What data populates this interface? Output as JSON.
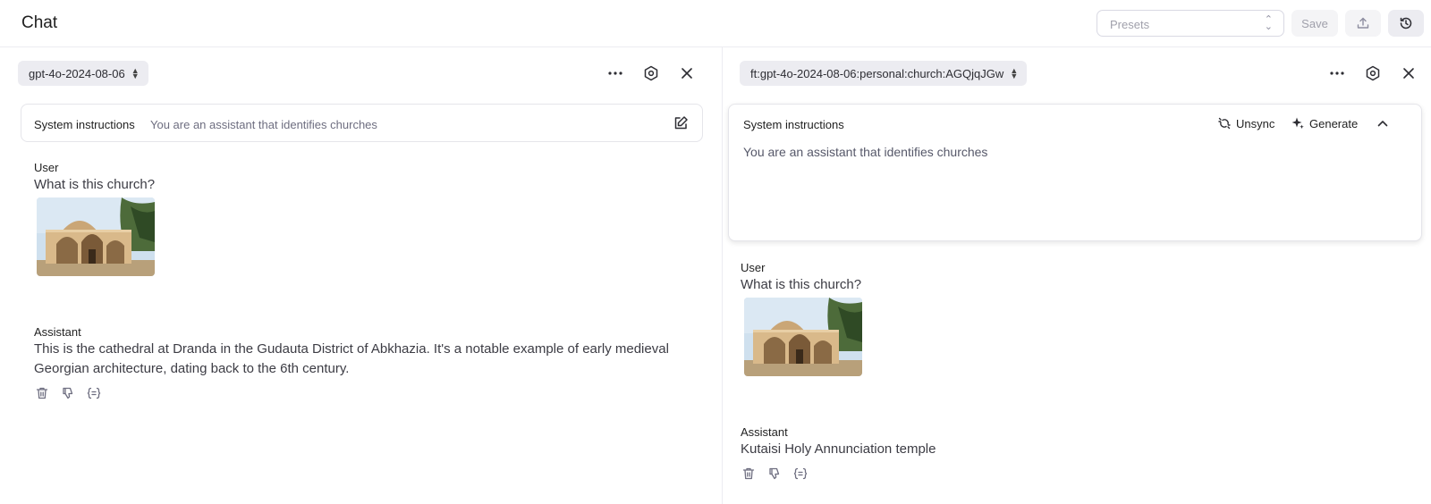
{
  "header": {
    "title": "Chat",
    "presets_placeholder": "Presets",
    "save_label": "Save"
  },
  "left_panel": {
    "model": "gpt-4o-2024-08-06",
    "system": {
      "label": "System instructions",
      "text": "You are an assistant that identifies churches"
    },
    "messages": [
      {
        "role": "User",
        "text": "What is this church?",
        "has_image": true
      },
      {
        "role": "Assistant",
        "text": "This is the cathedral at Dranda in the Gudauta District of Abkhazia. It's a notable example of early medieval Georgian architecture, dating back to the 6th century."
      }
    ],
    "tools": [
      "trash-icon",
      "thumbs-down-icon",
      "json-braces-icon"
    ]
  },
  "right_panel": {
    "model": "ft:gpt-4o-2024-08-06:personal:church:AGQjqJGw",
    "system": {
      "label": "System instructions",
      "unsync_label": "Unsync",
      "generate_label": "Generate",
      "text": "You are an assistant that identifies churches"
    },
    "messages": [
      {
        "role": "User",
        "text": "What is this church?",
        "has_image": true
      },
      {
        "role": "Assistant",
        "text": "Kutaisi Holy Annunciation temple"
      }
    ],
    "tools": [
      "trash-icon",
      "thumbs-down-icon",
      "json-braces-icon"
    ]
  },
  "colors": {
    "border": "#ececf1",
    "pill_bg": "#ececf1",
    "muted_text": "#6e6e80"
  }
}
